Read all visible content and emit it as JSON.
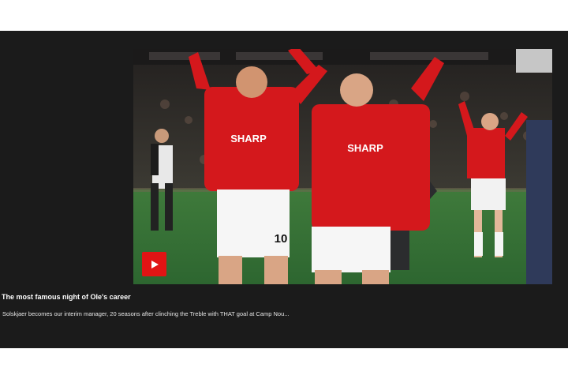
{
  "article": {
    "title": "The most famous night of Ole's career",
    "description": "Solskjaer becomes our interim manager, 20 seasons after clinching the Treble with THAT goal at Camp Nou...",
    "image": {
      "shirt_sponsor": "SHARP",
      "shirt_number": "10",
      "icon": "play-icon"
    }
  },
  "colors": {
    "card_background": "#1b1b1b",
    "play_button": "#e11414",
    "jersey_red": "#d4181c"
  }
}
